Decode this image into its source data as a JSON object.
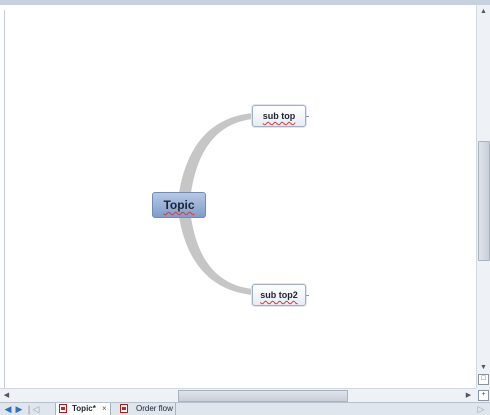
{
  "mindmap": {
    "central_topic": "Topic",
    "subtopics": [
      {
        "label": "sub top"
      },
      {
        "label": "sub top2"
      }
    ],
    "connector_color": "#c8c8c8"
  },
  "tabs": [
    {
      "label": "Topic*",
      "active": true,
      "close": "×"
    },
    {
      "label": "Order flow",
      "active": false
    }
  ],
  "nav": {
    "back_icon": "arrow-left",
    "forward_icon": "arrow-right",
    "separator": "|",
    "tab_scroll_left": "◁",
    "tab_scroll_right": "▷"
  },
  "scrollbars": {
    "up": "▲",
    "down": "▼",
    "left": "◀",
    "right": "▶",
    "zoom_box": "□",
    "zoom_plus": "+"
  }
}
